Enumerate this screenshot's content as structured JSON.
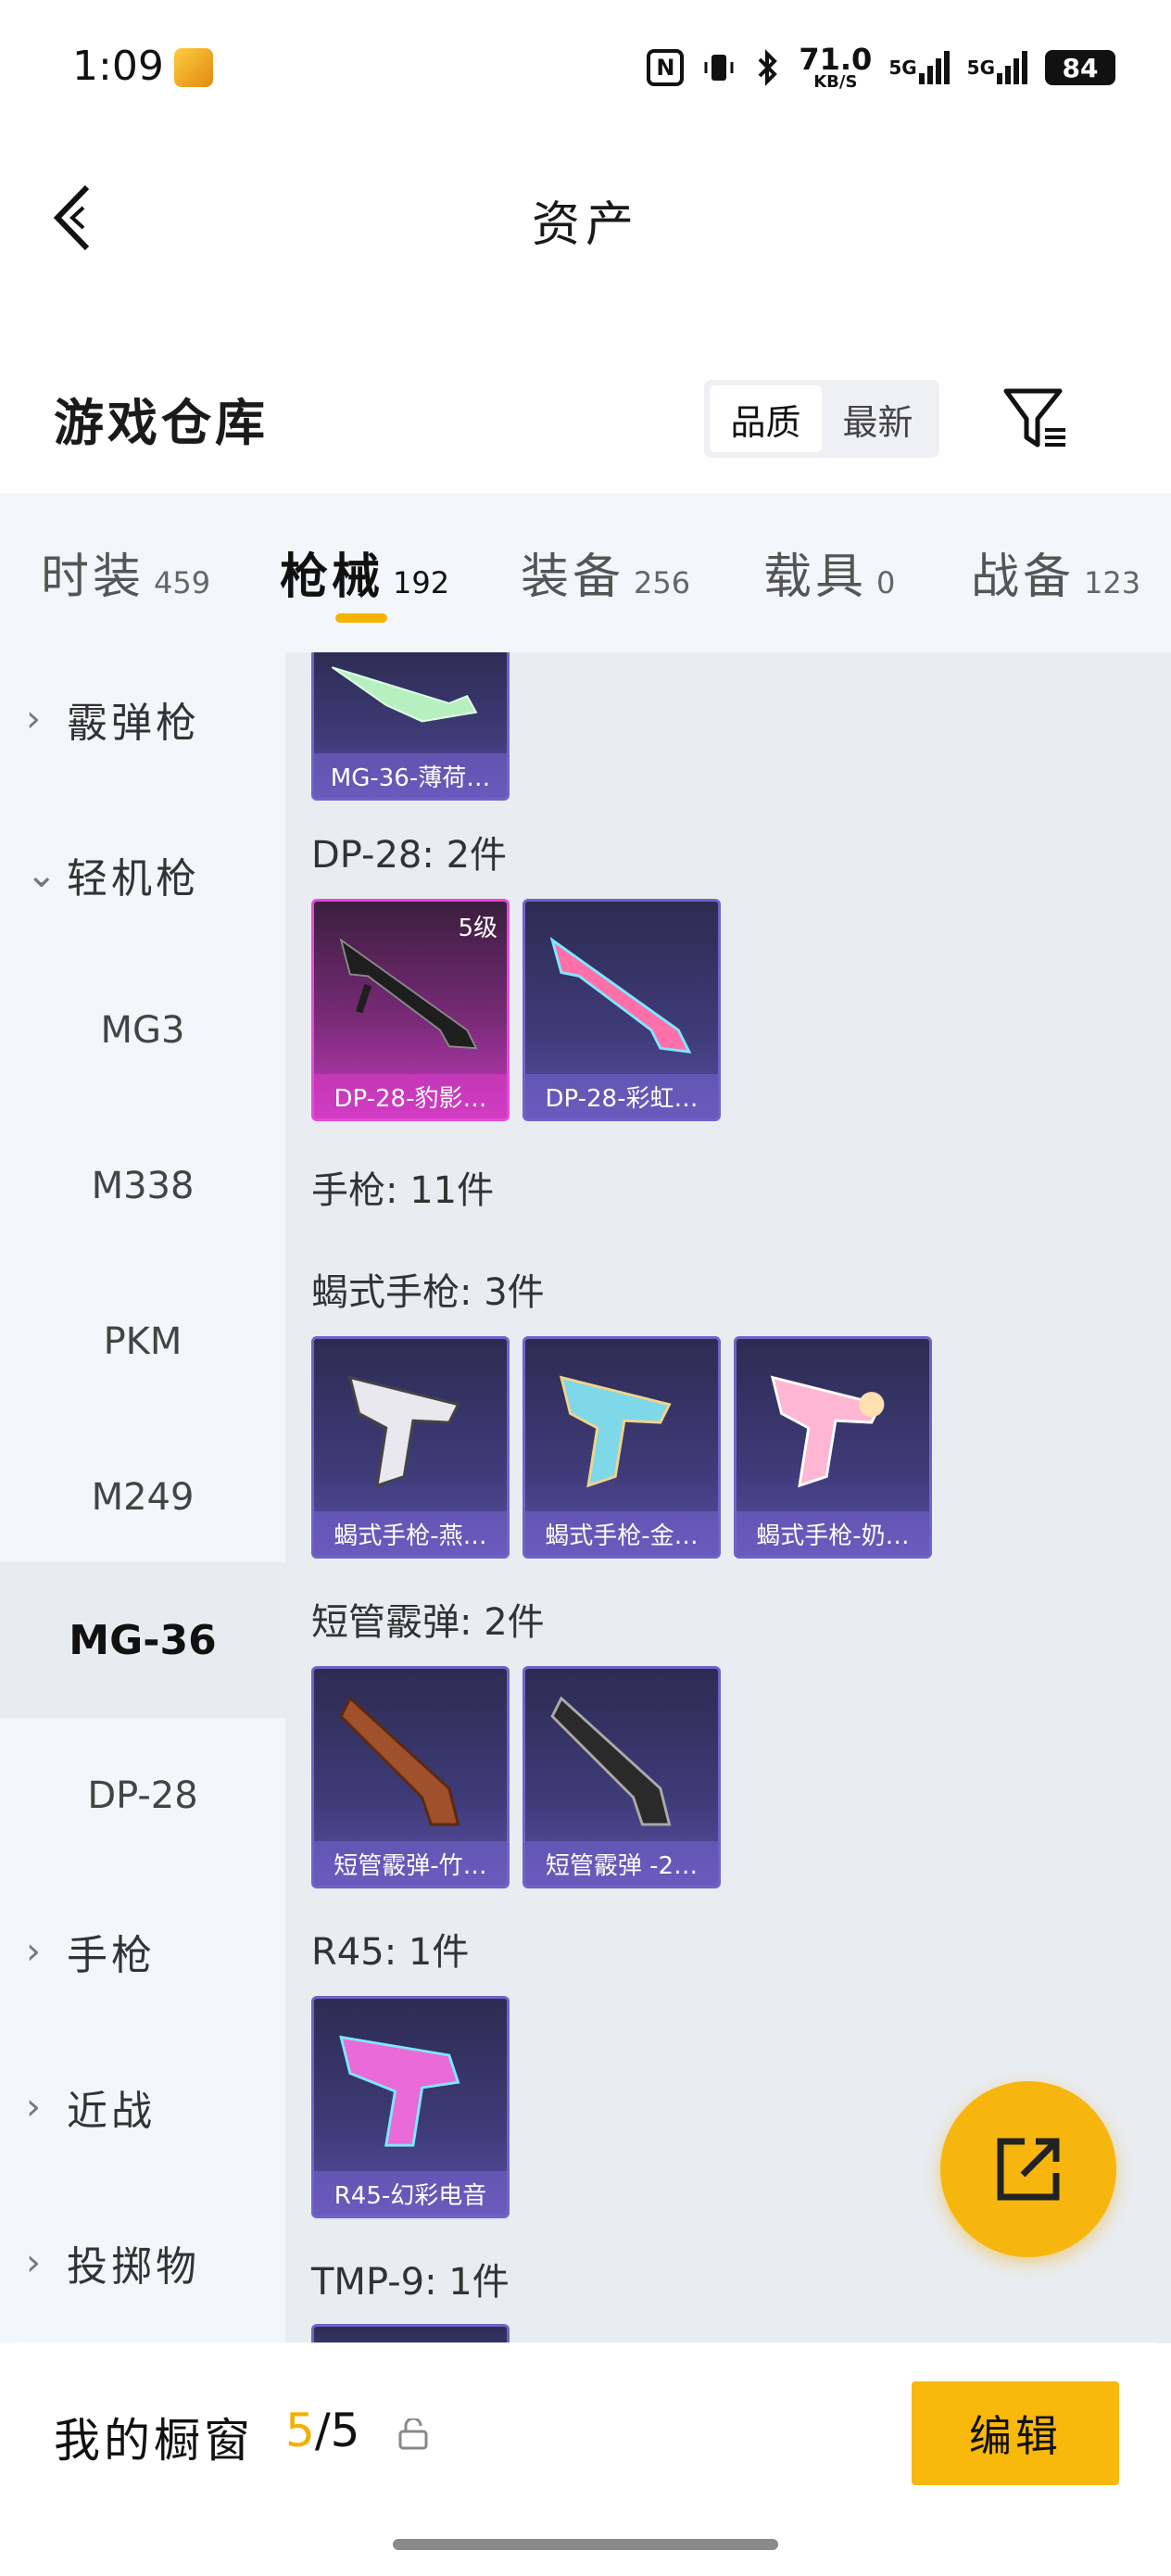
{
  "status_bar": {
    "time": "1:09",
    "speed_value": "71.0",
    "speed_unit": "KB/S",
    "net1": "5G",
    "net2": "5G",
    "battery": "84"
  },
  "nav": {
    "title": "资产"
  },
  "header": {
    "section_title": "游戏仓库",
    "sort_options": [
      "品质",
      "最新"
    ],
    "sort_active": "品质"
  },
  "tabs": [
    {
      "label": "时装",
      "count": "459"
    },
    {
      "label": "枪械",
      "count": "192"
    },
    {
      "label": "装备",
      "count": "256"
    },
    {
      "label": "载具",
      "count": "0"
    },
    {
      "label": "战备",
      "count": "123"
    }
  ],
  "active_tab": "枪械",
  "sidebar": {
    "items": [
      {
        "label": "霰弹枪",
        "kind": "parent",
        "expanded": false
      },
      {
        "label": "轻机枪",
        "kind": "parent",
        "expanded": true
      },
      {
        "label": "MG3",
        "kind": "sub"
      },
      {
        "label": "M338",
        "kind": "sub"
      },
      {
        "label": "PKM",
        "kind": "sub"
      },
      {
        "label": "M249",
        "kind": "sub"
      },
      {
        "label": "MG-36",
        "kind": "sub",
        "selected": true
      },
      {
        "label": "DP-28",
        "kind": "sub"
      },
      {
        "label": "手枪",
        "kind": "parent",
        "expanded": false
      },
      {
        "label": "近战",
        "kind": "parent",
        "expanded": false
      },
      {
        "label": "投掷物",
        "kind": "parent",
        "expanded": false
      }
    ]
  },
  "content": {
    "top_card": {
      "name": "MG-36-薄荷…"
    },
    "groups": [
      {
        "label": "DP-28: 2件",
        "cards": [
          {
            "name": "DP-28-豹影…",
            "level": "5级",
            "rarity": "pink"
          },
          {
            "name": "DP-28-彩虹…",
            "rarity": "purple"
          }
        ]
      },
      {
        "label": "手枪: 11件",
        "cards": []
      },
      {
        "label": "蝎式手枪: 3件",
        "cards": [
          {
            "name": "蝎式手枪-燕…",
            "rarity": "purple"
          },
          {
            "name": "蝎式手枪-金…",
            "rarity": "purple"
          },
          {
            "name": "蝎式手枪-奶…",
            "rarity": "purple"
          }
        ]
      },
      {
        "label": "短管霰弹: 2件",
        "cards": [
          {
            "name": "短管霰弹-竹…",
            "rarity": "purple"
          },
          {
            "name": "短管霰弹 -2…",
            "rarity": "purple"
          }
        ]
      },
      {
        "label": "R45: 1件",
        "cards": [
          {
            "name": "R45-幻彩电音",
            "rarity": "purple"
          }
        ]
      },
      {
        "label": "TMP-9: 1件",
        "cards": []
      }
    ]
  },
  "bottom": {
    "showcase_label": "我的橱窗",
    "showcase_current": "5",
    "showcase_total": "/5",
    "edit_label": "编辑"
  },
  "colors": {
    "accent": "#f5b400",
    "card_purple": "#5a4fa6",
    "card_pink": "#c43cbf",
    "sidebar_bg": "#f3f6fb",
    "content_bg": "#e9ecf1"
  }
}
